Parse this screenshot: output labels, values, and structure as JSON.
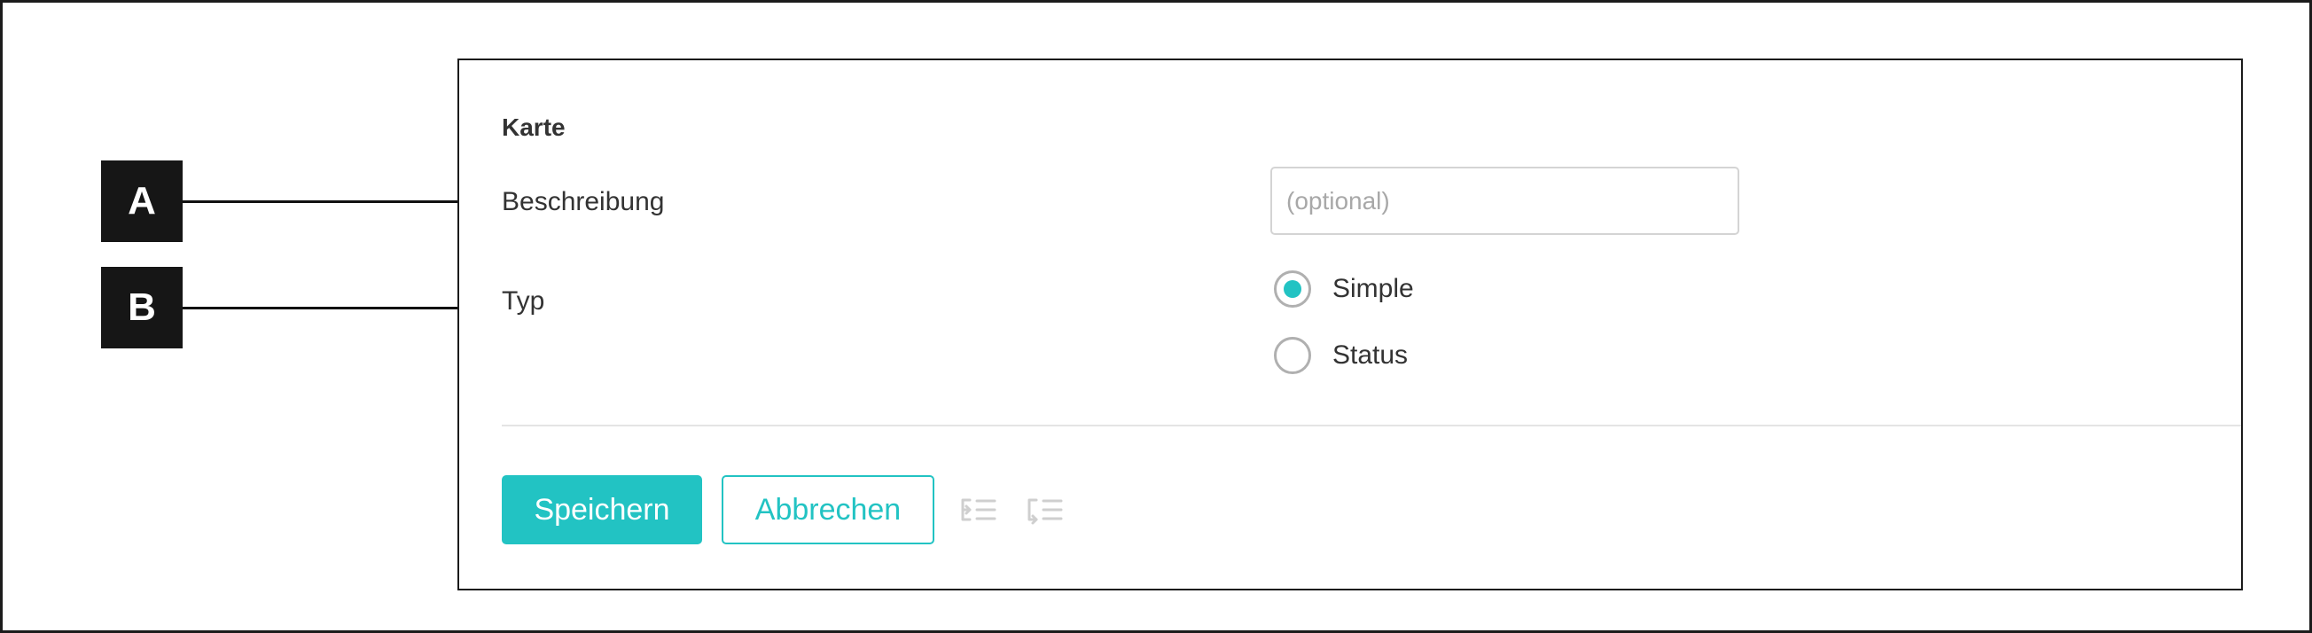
{
  "form": {
    "section_title": "Karte",
    "description": {
      "label": "Beschreibung",
      "placeholder": "(optional)",
      "value": ""
    },
    "type": {
      "label": "Typ",
      "options": [
        {
          "label": "Simple",
          "selected": true
        },
        {
          "label": "Status",
          "selected": false
        }
      ]
    }
  },
  "actions": {
    "save_label": "Speichern",
    "cancel_label": "Abbrechen",
    "icons": [
      "outdent-icon",
      "indent-icon"
    ]
  },
  "callouts": {
    "a": "A",
    "b": "B"
  },
  "colors": {
    "accent": "#22c3c3",
    "callout_bg": "#161616",
    "text": "#333333",
    "placeholder": "#a8a8a8"
  }
}
